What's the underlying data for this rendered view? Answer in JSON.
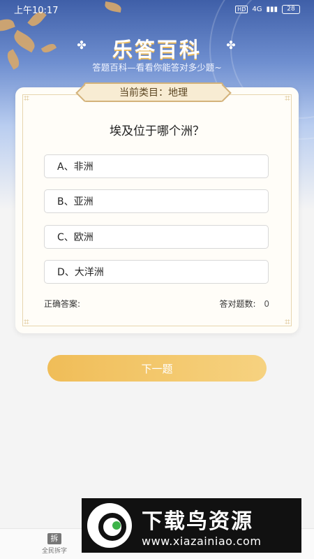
{
  "status_bar": {
    "time": "上午10:17",
    "hd": "HD",
    "network": "4G",
    "battery": "28"
  },
  "header": {
    "title": "乐答百科",
    "subtitle": "答题百科—看看你能答对多少题~"
  },
  "quiz": {
    "category_label": "当前类目：地理",
    "question": "埃及位于哪个洲？",
    "options": [
      {
        "label": "A、非洲"
      },
      {
        "label": "B、亚洲"
      },
      {
        "label": "C、欧洲"
      },
      {
        "label": "D、大洋洲"
      }
    ],
    "correct_answer_label": "正确答案:",
    "correct_answer_value": "",
    "score_label": "答对题数:",
    "score_value": "0",
    "next_button": "下一题"
  },
  "bottom_nav": [
    {
      "label": "全民拆字",
      "icon": "拆"
    }
  ],
  "watermark": {
    "title": "下载鸟资源",
    "url": "www.xiazainiao.com"
  },
  "colors": {
    "accent": "#f0bd58",
    "hero": "#3f5fa8",
    "card_border": "#d3b27a"
  }
}
